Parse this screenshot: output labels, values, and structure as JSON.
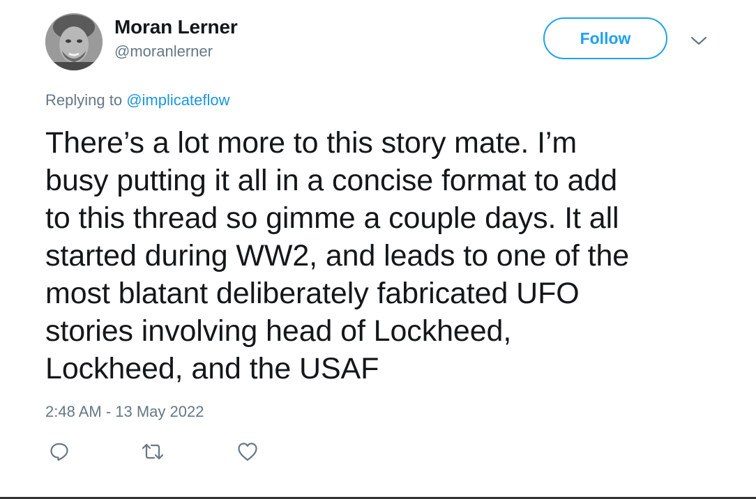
{
  "author": {
    "name": "Moran Lerner",
    "handle": "@moranlerner"
  },
  "follow_label": "Follow",
  "reply": {
    "prefix": "Replying to ",
    "mention": "@implicateflow"
  },
  "tweet": {
    "text": "There’s a lot more to this story mate. I’m\nbusy putting it all in a concise format to add\nto this thread so gimme a couple days. It all\nstarted during WW2, and leads to one of the\nmost blatant deliberately fabricated UFO\nstories involving head of Lockheed,\nLockheed, and the USAF",
    "timestamp": "2:48 AM - 13 May 2022"
  },
  "icons": {
    "more": "chevron-down-icon",
    "reply": "reply-icon",
    "retweet": "retweet-icon",
    "like": "heart-icon"
  },
  "colors": {
    "accent": "#1da1f2",
    "secondary_text": "#657786",
    "primary_text": "#14171a"
  }
}
